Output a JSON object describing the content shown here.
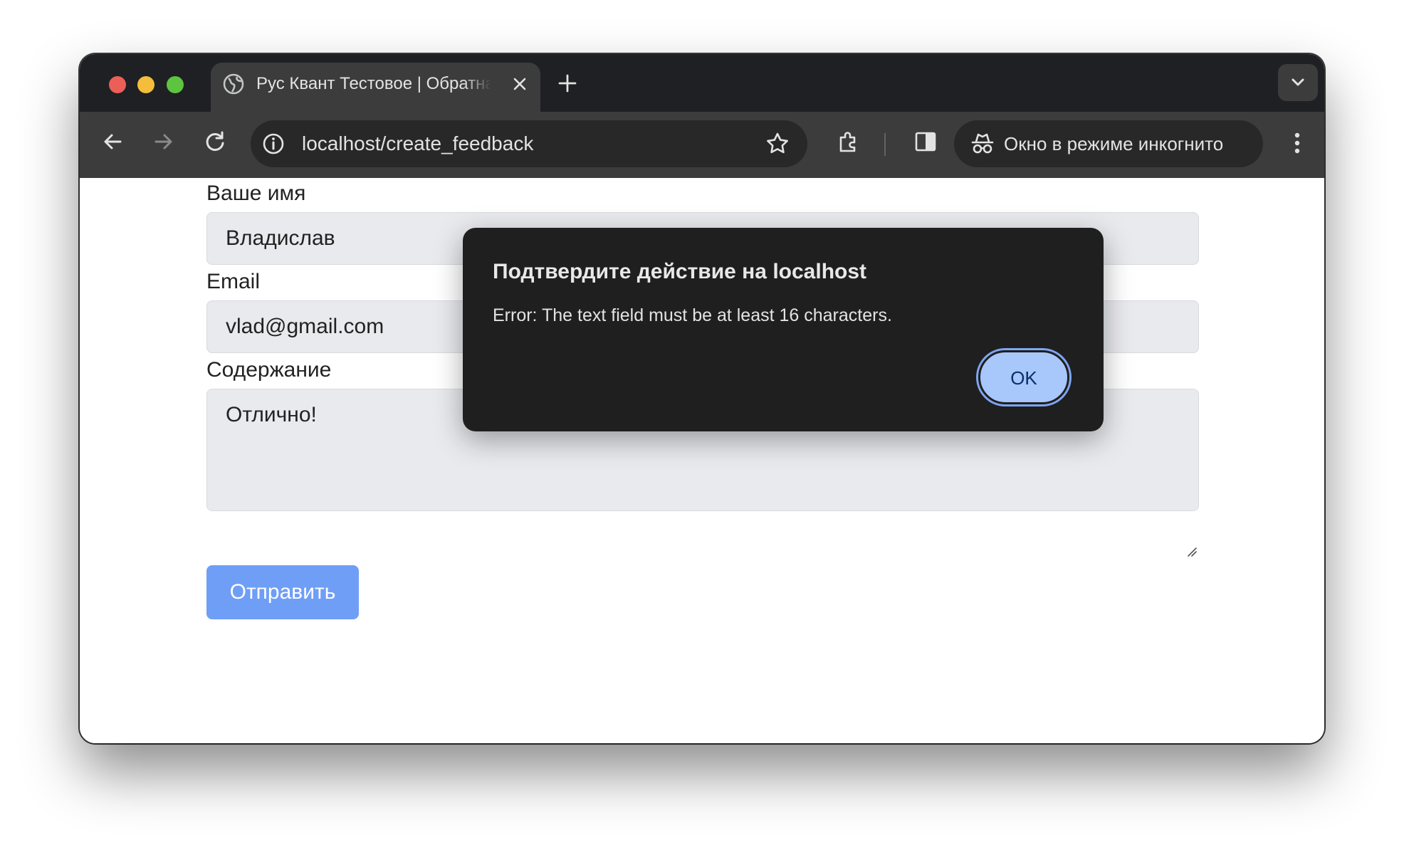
{
  "browser": {
    "tab_title": "Рус Квант Тестовое | Обратная связь",
    "url": "localhost/create_feedback",
    "incognito_label": "Окно в режиме инкогнито"
  },
  "form": {
    "name_label": "Ваше имя",
    "name_value": "Владислав",
    "email_label": "Email",
    "email_value": "vlad@gmail.com",
    "content_label": "Содержание",
    "content_value": "Отлично!",
    "submit_label": "Отправить"
  },
  "dialog": {
    "title": "Подтвердите действие на localhost",
    "message": "Error: The text field must be at least 16 characters.",
    "ok_label": "OK"
  },
  "colors": {
    "titlebar": "#1f2023",
    "toolbar": "#3c3c3c",
    "dialog_bg": "#1f1f1f",
    "ok_button": "#a8c7fa",
    "submit_button": "#6f9ef6",
    "input_bg": "#e9eaee"
  }
}
